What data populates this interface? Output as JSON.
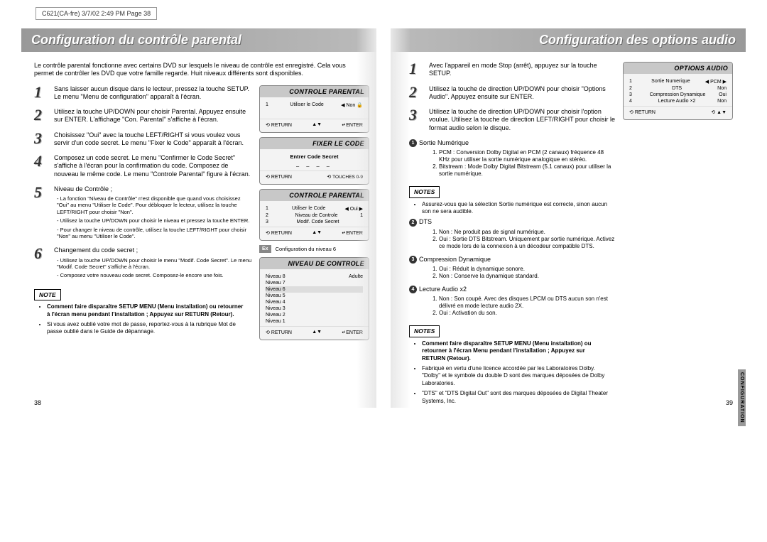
{
  "meta": {
    "header": "C621(CA-fre) 3/7/02 2:49 PM Page 38"
  },
  "left": {
    "title": "Configuration du contrôle parental",
    "intro": "Le contrôle parental fonctionne avec certains DVD sur lesquels le niveau de contrôle est enregistré. Cela vous permet de contrôler les DVD que votre famille regarde. Huit niveaux différents sont disponibles.",
    "steps": [
      {
        "n": "1",
        "text": "Sans laisser aucun disque dans le lecteur, pressez la touche SETUP. Le menu \"Menu de configuration\" apparaît à l'écran."
      },
      {
        "n": "2",
        "text": "Utilisez la touche UP/DOWN pour choisir Parental. Appuyez ensuite sur ENTER. L'affichage \"Con. Parental\" s'affiche à l'écran."
      },
      {
        "n": "3",
        "text": "Choisissez \"Oui\" avec la touche LEFT/RIGHT si vous voulez vous servir d'un code secret. Le menu \"Fixer le Code\" apparaît à l'écran."
      },
      {
        "n": "4",
        "text": "Composez un code secret. Le menu \"Confirmer le Code Secret\" s'affiche à l'écran pour la confirmation du code. Composez de nouveau le même code. Le menu \"Controle Parental\" figure à l'écran."
      },
      {
        "n": "5",
        "text": "Niveau de Contrôle ;",
        "sub": [
          "La fonction \"Niveau de Contrôle\" n'est disponible que quand vous choisissez \"Oui\" au menu \"Utiliser le Code\". Pour débloquer le lecteur, utilisez la touche LEFT/RIGHT pour choisir \"Non\".",
          "Utilisez la touche UP/DOWN pour choisir le niveau et pressez la touche ENTER.",
          "Pour changer le niveau de contrôle, utilisez la touche LEFT/RIGHT pour choisir \"Non\" au menu \"Utiliser le Code\"."
        ]
      },
      {
        "n": "6",
        "text": "Changement du code secret ;",
        "sub": [
          "Utilisez la touche UP/DOWN pour choisir le menu \"Modif. Code Secret\". Le menu \"Modif. Code Secret\" s'affiche à l'écran.",
          "Composez votre nouveau code secret. Composez-le encore une fois."
        ]
      }
    ],
    "screens": {
      "s1": {
        "title": "CONTROLE PARENTAL",
        "row": {
          "n": "1",
          "l": "Utiliser le Code",
          "r": "◀ Non 🔒"
        },
        "foot_l": "RETURN",
        "foot_r2": "",
        "foot_r3": "ENTER"
      },
      "s2": {
        "title": "FIXER LE CODE",
        "body": "Entrer Code Secret",
        "dashes": "– – – –",
        "foot_l": "RETURN",
        "foot_r": "TOUCHES 0-9"
      },
      "s3": {
        "title": "CONTROLE PARENTAL",
        "rows": [
          {
            "n": "1",
            "l": "Utiliser le Code",
            "r": "◀ Oui ▶"
          },
          {
            "n": "2",
            "l": "Niveau de Controle",
            "r": "1"
          },
          {
            "n": "3",
            "l": "Modif. Code Secret",
            "r": ""
          }
        ],
        "foot_l": "RETURN",
        "foot_r2": "",
        "foot_r3": "ENTER"
      },
      "ex": {
        "tag": "Ex",
        "text": "Configuration du niveau 6"
      },
      "s4": {
        "title": "NIVEAU DE CONTROLE",
        "rows": [
          {
            "l": "Niveau 8",
            "r": "Adulte"
          },
          {
            "l": "Niveau 7",
            "r": ""
          },
          {
            "l": "Niveau 6",
            "r": ""
          },
          {
            "l": "Niveau 5",
            "r": ""
          },
          {
            "l": "Niveau 4",
            "r": ""
          },
          {
            "l": "Niveau 3",
            "r": ""
          },
          {
            "l": "Niveau 2",
            "r": ""
          },
          {
            "l": "Niveau 1",
            "r": ""
          }
        ],
        "foot_l": "RETURN",
        "foot_r2": "",
        "foot_r3": "ENTER"
      }
    },
    "note_label": "NOTE",
    "notes": [
      "Comment faire disparaître SETUP MENU (Menu installation) ou retourner à l'écran menu pendant l'installation ; Appuyez sur RETURN (Retour).",
      "Si vous avez oublié votre mot de passe, reportez-vous à la rubrique Mot de passe oublié dans le Guide de dépannage."
    ],
    "pagenum": "38"
  },
  "right": {
    "title": "Configuration des options audio",
    "steps": [
      {
        "n": "1",
        "text": "Avec l'appareil en mode Stop (arrêt), appuyez sur la touche SETUP."
      },
      {
        "n": "2",
        "text": "Utilisez la touche de direction UP/DOWN pour choisir \"Options Audio\". Appuyez ensuite sur ENTER."
      },
      {
        "n": "3",
        "text": "Utilisez la touche de direction UP/DOWN pour choisir l'option voulue. Utilisez la touche de direction LEFT/RIGHT pour choisir le format audio selon le disque."
      }
    ],
    "screen": {
      "title": "OPTIONS AUDIO",
      "rows": [
        {
          "n": "1",
          "l": "Sortie Numerique",
          "r": "◀ PCM ▶"
        },
        {
          "n": "2",
          "l": "DTS",
          "r": "Non"
        },
        {
          "n": "3",
          "l": "Compression Dynamique",
          "r": "Oui"
        },
        {
          "n": "4",
          "l": "Lecture Audio ×2",
          "r": "Non"
        }
      ],
      "foot_l": "RETURN",
      "foot_r2": "▲▼"
    },
    "details": [
      {
        "num": "1",
        "hdr": "Sortie Numérique",
        "items": [
          "PCM : Conversion Dolby Digital en PCM (2 canaux) fréquence 48 KHz pour utiliser la sortie numérique analogique en stéréo.",
          "Bitstream : Mode Dolby Digital Bitstream (5.1 canaux) pour utiliser la sortie numérique."
        ]
      },
      {
        "num": "2",
        "hdr": "DTS",
        "items": [
          "Non : Ne produit pas de signal numérique.",
          "Oui : Sortie DTS Bitstream. Uniquement par sortie numérique. Activez ce mode lors de la connexion à un décodeur compatible DTS."
        ]
      },
      {
        "num": "3",
        "hdr": "Compression Dynamique",
        "items": [
          "Oui : Réduit la dynamique sonore.",
          "Non : Conserve la dynamique standard."
        ]
      },
      {
        "num": "4",
        "hdr": "Lecture Audio x2",
        "items": [
          "Non : Son coupé. Avec des disques LPCM ou DTS aucun son n'est délivré en mode lecture audio 2X.",
          "Oui : Activation du son."
        ]
      }
    ],
    "notes_label": "NOTES",
    "mid_note": [
      "Assurez-vous que la sélection Sortie numérique est correcte, sinon aucun son ne sera audible."
    ],
    "bottom_notes": [
      "Comment faire disparaître SETUP MENU (Menu installation) ou retourner à l'écran Menu pendant l'installation ; Appuyez sur RETURN (Retour).",
      "Fabriqué en vertu d'une licence accordée par les Laboratoires Dolby. \"Dolby\" et le symbole du double D sont des marques déposées de Dolby Laboratories.",
      "\"DTS\" et \"DTS Digital Out\" sont des marques déposées de Digital Theater Systems, Inc."
    ],
    "sidetab": "CONFIGURATION",
    "pagenum": "39"
  }
}
